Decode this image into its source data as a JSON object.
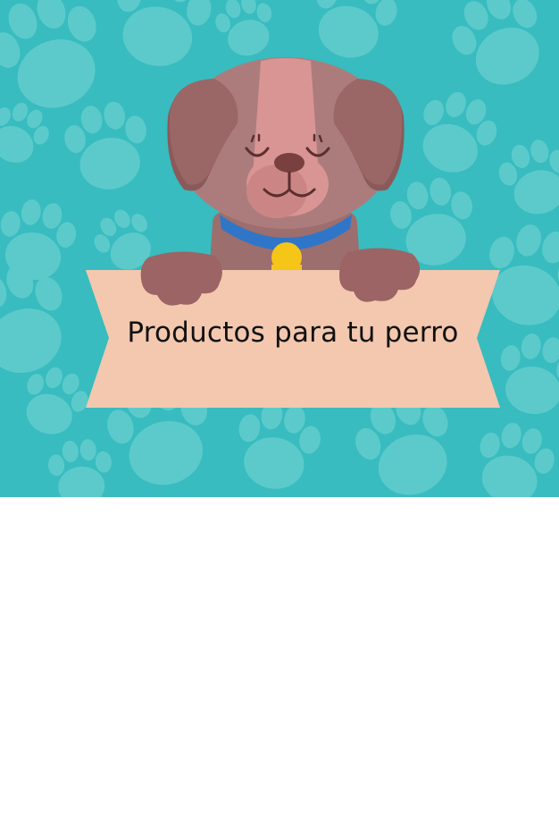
{
  "banner": {
    "title": "Productos para tu perro",
    "colors": {
      "background": "#38bcbf",
      "paw_prints": "#5ccacb",
      "ribbon": "#f3c8ae",
      "dog_head": "#ac7c7c",
      "dog_ears": "#956464",
      "dog_face_stripe": "#d99494",
      "collar": "#2f76c8",
      "tag": "#f5c518"
    },
    "icons": [
      "paw-print-icon",
      "dog-illustration"
    ]
  }
}
